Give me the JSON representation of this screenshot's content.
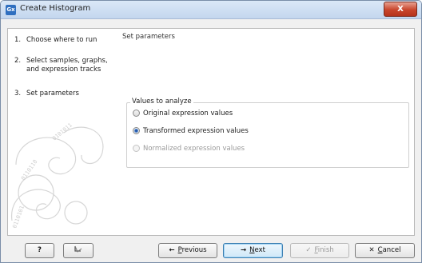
{
  "window": {
    "title": "Create Histogram",
    "app_icon_text": "Gx",
    "close_label": "X"
  },
  "steps": [
    {
      "number": "1.",
      "label": "Choose where to run"
    },
    {
      "number": "2.",
      "label": "Select samples, graphs, and expression tracks"
    },
    {
      "number": "3.",
      "label": "Set parameters"
    }
  ],
  "main": {
    "section_title": "Set parameters",
    "group_title": "Values to analyze",
    "options": [
      {
        "label": "Original expression values",
        "selected": false,
        "enabled": true
      },
      {
        "label": "Transformed expression values",
        "selected": true,
        "enabled": true
      },
      {
        "label": "Normalized expression values",
        "selected": false,
        "enabled": false
      }
    ]
  },
  "buttons": {
    "help": "?",
    "reset_icon": "reset-icon",
    "previous": {
      "icon": "←",
      "prefix": "",
      "mnemonic": "P",
      "rest": "revious"
    },
    "next": {
      "icon": "→",
      "prefix": "",
      "mnemonic": "N",
      "rest": "ext"
    },
    "finish": {
      "icon": "✓",
      "prefix": "",
      "mnemonic": "F",
      "rest": "inish"
    },
    "cancel": {
      "icon": "✕",
      "prefix": "",
      "mnemonic": "C",
      "rest": "ancel"
    }
  }
}
